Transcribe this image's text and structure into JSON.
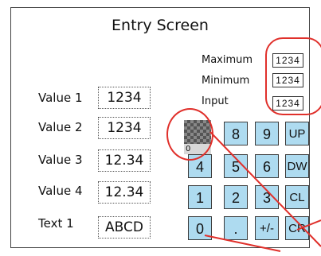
{
  "screen": {
    "title": "Entry Screen"
  },
  "range": {
    "max_label": "Maximum",
    "max_value": "1234",
    "min_label": "Minimum",
    "min_value": "1234",
    "input_label": "Input",
    "input_value": "1234"
  },
  "entries": [
    {
      "label": "Value 1",
      "value": "1234"
    },
    {
      "label": "Value 2",
      "value": "1234"
    },
    {
      "label": "Value 3",
      "value": "12.34"
    },
    {
      "label": "Value 4",
      "value": "12.34"
    },
    {
      "label": "Text 1",
      "value": "ABCD"
    }
  ],
  "keypad": {
    "image_key_caption": "0",
    "keys": [
      "8",
      "9",
      "UP",
      "4",
      "5",
      "6",
      "DW",
      "1",
      "2",
      "3",
      "CL",
      "0",
      ".",
      "+/-",
      "CR"
    ]
  },
  "colors": {
    "key_fill": "#aedbf0",
    "callout": "#e0302b"
  }
}
